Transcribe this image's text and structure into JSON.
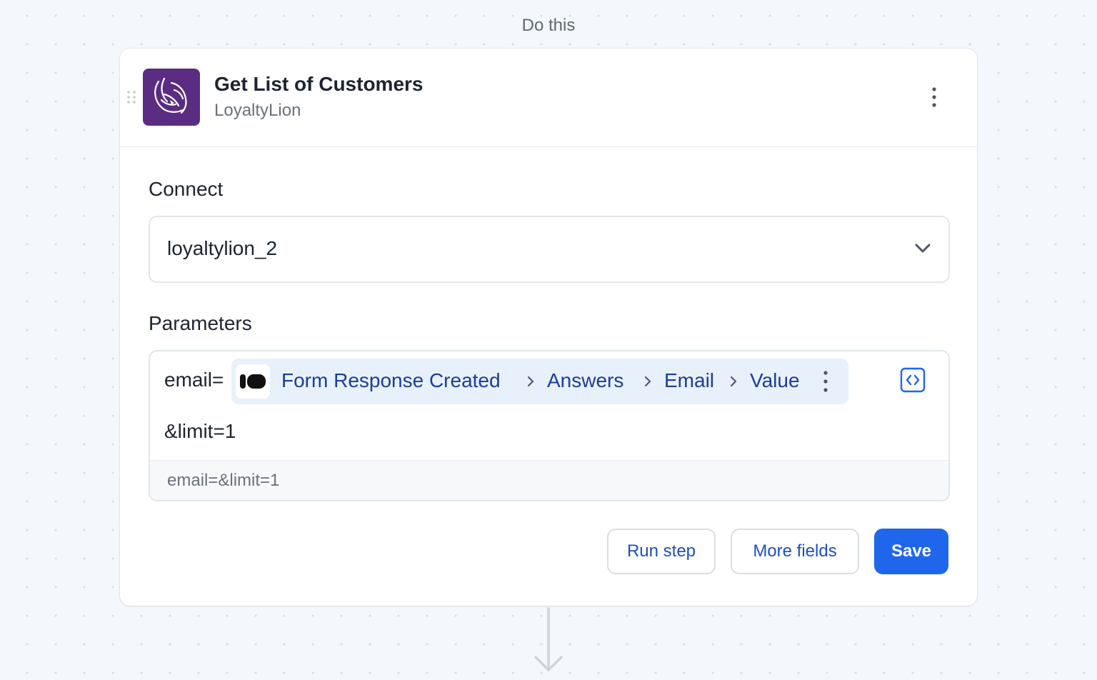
{
  "section_label": "Do this",
  "step": {
    "title": "Get List of Customers",
    "app_name": "LoyaltyLion",
    "logo_icon": "loyaltylion-logo-icon",
    "menu_icon": "kebab-menu-icon"
  },
  "connect": {
    "heading": "Connect",
    "selected_account": "loyaltylion_2",
    "dropdown_icon": "chevron-down-icon"
  },
  "parameters": {
    "heading": "Parameters",
    "prefix": "email=",
    "token": {
      "source_icon": "typeform-icon",
      "path": [
        "Form Response Created",
        "Answers",
        "Email",
        "Value"
      ],
      "separator_icon": "chevron-right-icon",
      "menu_icon": "kebab-menu-icon"
    },
    "line2": "&limit=1",
    "preview": "email=&limit=1",
    "code_toggle_icon": "code-brackets-icon"
  },
  "actions": {
    "run_step_label": "Run step",
    "more_fields_label": "More fields",
    "save_label": "Save"
  },
  "colors": {
    "brand_purple": "#5a2d82",
    "primary_blue": "#1f66ec",
    "token_bg": "#e8f1fb",
    "token_text": "#1b3d9a"
  }
}
